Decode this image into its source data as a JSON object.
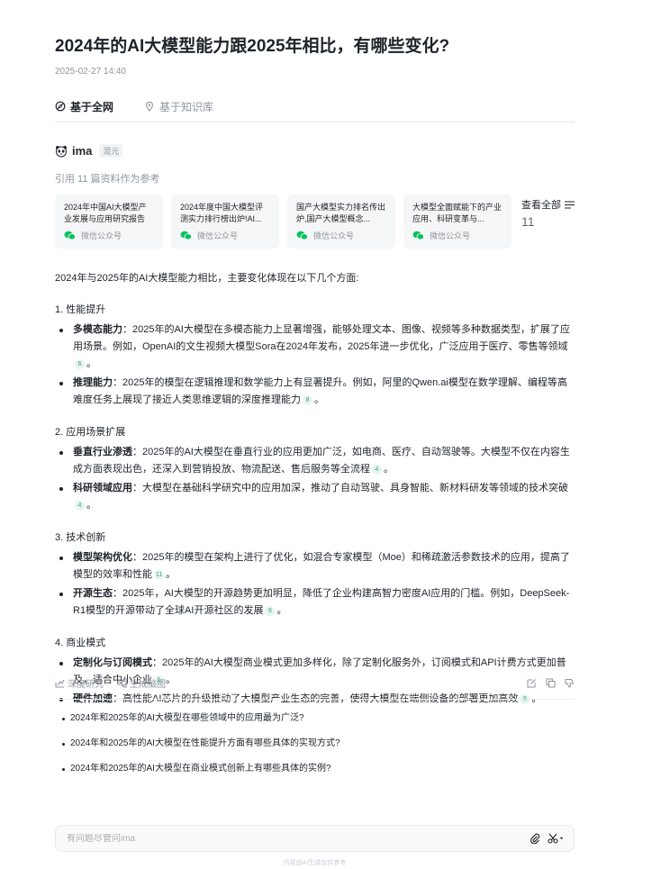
{
  "title": "2024年的AI大模型能力跟2025年相比，有哪些变化?",
  "date": "2025-02-27 14:40",
  "tabs": [
    {
      "label": "基于全网",
      "active": true
    },
    {
      "label": "基于知识库",
      "active": false
    }
  ],
  "author": {
    "name": "ima",
    "badge": "混元"
  },
  "refs_label": "引用 11 篇资料作为参考",
  "cards": [
    {
      "title": "2024年中国AI大模型产业发展与应用研究报告",
      "source": "微信公众号"
    },
    {
      "title": "2024年度中国大模型评测实力排行榜出炉!AI...",
      "source": "微信公众号"
    },
    {
      "title": "国产大模型实力排名传出炉,国产大模型概念...",
      "source": "微信公众号"
    },
    {
      "title": "大模型全面赋能下的产业应用、科研变革与...",
      "source": "微信公众号"
    }
  ],
  "view_all": {
    "label": "查看全部",
    "count": "11"
  },
  "intro": "2024年与2025年的AI大模型能力相比，主要变化体现在以下几个方面:",
  "sections": [
    {
      "heading": "1. 性能提升",
      "items": [
        {
          "bold": "多模态能力",
          "text": "：2025年的AI大模型在多模态能力上显著增强，能够处理文本、图像、视频等多种数据类型，扩展了应用场景。例如，OpenAI的文生视频大模型Sora在2024年发布，2025年进一步优化，广泛应用于医疗、零售等领域",
          "cite": "6",
          "end": "。"
        },
        {
          "bold": "推理能力",
          "text": "：2025年的模型在逻辑推理和数学能力上有显著提升。例如，阿里的Qwen.ai模型在数学理解、编程等高难度任务上展现了接近人类思维逻辑的深度推理能力",
          "cite": "8",
          "end": "。"
        }
      ]
    },
    {
      "heading": "2. 应用场景扩展",
      "items": [
        {
          "bold": "垂直行业渗透",
          "text": "：2025年的AI大模型在垂直行业的应用更加广泛，如电商、医疗、自动驾驶等。大模型不仅在内容生成方面表现出色，还深入到营销投放、物流配送、售后服务等全流程",
          "cite": "4",
          "end": "。"
        },
        {
          "bold": "科研领域应用",
          "text": "：大模型在基础科学研究中的应用加深，推动了自动驾驶、具身智能、新材料研发等领域的技术突破",
          "cite": "4",
          "end": "。"
        }
      ]
    },
    {
      "heading": "3. 技术创新",
      "items": [
        {
          "bold": "模型架构优化",
          "text": "：2025年的模型在架构上进行了优化，如混合专家模型（Moe）和稀疏激活参数技术的应用，提高了模型的效率和性能",
          "cite": "11",
          "end": "。"
        },
        {
          "bold": "开源生态",
          "text": "：2025年，AI大模型的开源趋势更加明显，降低了企业构建高智力密度AI应用的门槛。例如，DeepSeek-R1模型的开源带动了全球AI开源社区的发展",
          "cite": "6",
          "end": "。"
        }
      ]
    },
    {
      "heading": "4. 商业模式",
      "items": [
        {
          "bold": "定制化与订阅模式",
          "text": "：2025年的AI大模型商业模式更加多样化，除了定制化服务外，订阅模式和API计费方式更加普及，适合中小企业",
          "cite": "1",
          "end": "。"
        },
        {
          "bold": "硬件加速",
          "text": "：高性能AI芯片的升级推动了大模型产业生态的完善，使得大模型在端侧设备的部署更加高效",
          "cite": "6",
          "end": "。"
        }
      ]
    }
  ],
  "actions": {
    "deep_research": "深度研究",
    "mindmap": "生成脑图"
  },
  "followups": [
    "2024年和2025年的AI大模型在哪些领域中的应用最为广泛?",
    "2024年和2025年的AI大模型在性能提升方面有哪些具体的实现方式?",
    "2024年和2025年的AI大模型在商业模式创新上有哪些具体的实例?"
  ],
  "input": {
    "placeholder": "有问题尽管问ima"
  },
  "footnote": "内容由AI生成仅供参考",
  "colors": {
    "accent_green": "#3aa76d",
    "wechat_green": "#07c160",
    "muted": "#8f959e"
  }
}
